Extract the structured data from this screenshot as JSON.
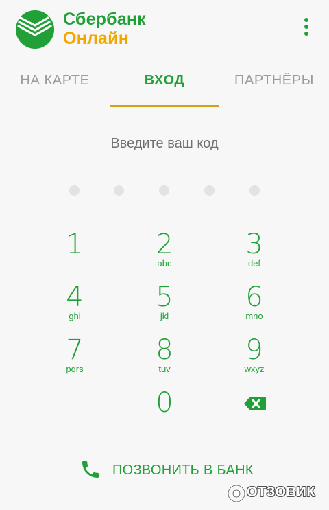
{
  "header": {
    "brand_line1": "Сбербанк",
    "brand_line2": "Онлайн",
    "brand_green": "#21a038",
    "brand_gold": "#f2a700"
  },
  "tabs": [
    {
      "label": "НА КАРТЕ",
      "active": false
    },
    {
      "label": "ВХОД",
      "active": true
    },
    {
      "label": "ПАРТНЁРЫ",
      "active": false
    }
  ],
  "pin": {
    "prompt": "Введите ваш код",
    "length": 5,
    "entered": 0
  },
  "keypad": [
    {
      "digit": "1",
      "letters": ""
    },
    {
      "digit": "2",
      "letters": "abc"
    },
    {
      "digit": "3",
      "letters": "def"
    },
    {
      "digit": "4",
      "letters": "ghi"
    },
    {
      "digit": "5",
      "letters": "jkl"
    },
    {
      "digit": "6",
      "letters": "mno"
    },
    {
      "digit": "7",
      "letters": "pqrs"
    },
    {
      "digit": "8",
      "letters": "tuv"
    },
    {
      "digit": "9",
      "letters": "wxyz"
    },
    {
      "digit": "0",
      "letters": ""
    }
  ],
  "backspace_icon": "backspace-icon",
  "call_bank": {
    "label": "ПОЗВОНИТЬ В БАНК",
    "icon": "phone-icon"
  },
  "watermark": {
    "text": "ОТЗОВИК"
  }
}
